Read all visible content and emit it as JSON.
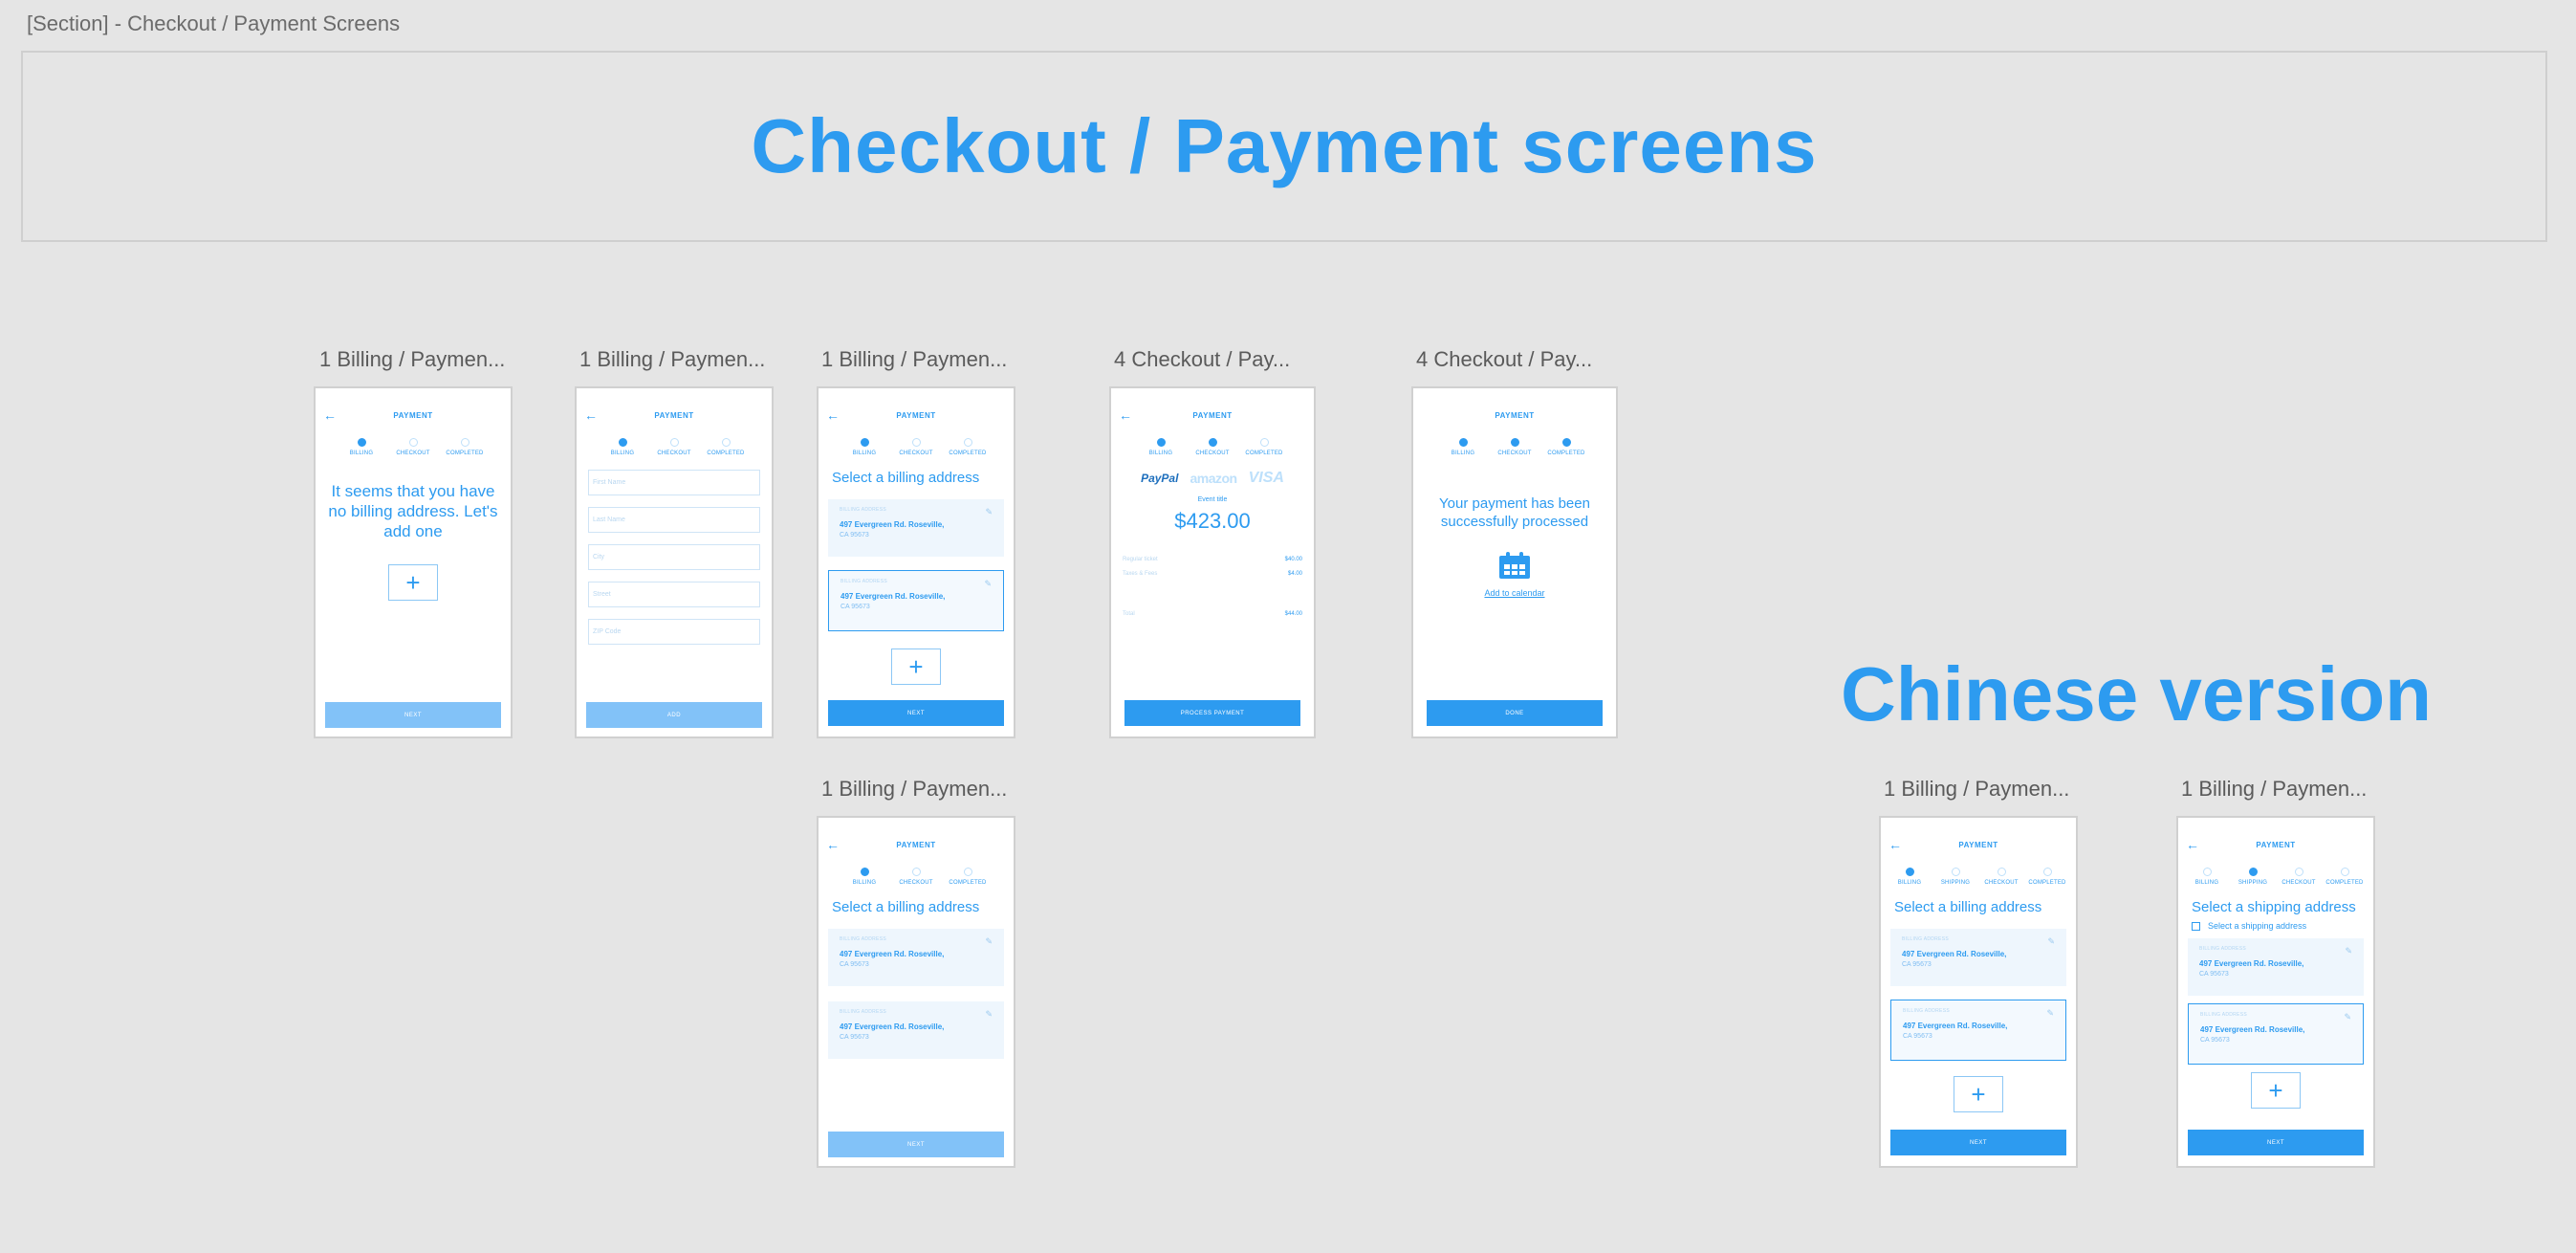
{
  "section_label": "[Section] - Checkout / Payment Screens",
  "banner_title": "Checkout / Payment screens",
  "chinese_title": "Chinese version",
  "labels": {
    "billing": "1 Billing / Paymen...",
    "checkout": "4 Checkout / Pay..."
  },
  "screen": {
    "header_title": "PAYMENT",
    "back_icon": "arrow-left-icon",
    "steps3": [
      "BILLING",
      "CHECKOUT",
      "COMPLETED"
    ],
    "steps4": [
      "BILLING",
      "SHIPPING",
      "CHECKOUT",
      "COMPLETED"
    ]
  },
  "empty_message": "It seems that you have no billing address. Let's add one",
  "next_label": "NEXT",
  "add_label": "ADD",
  "done_label": "DONE",
  "process_label": "PROCESS PAYMENT",
  "form_placeholders": [
    "First Name",
    "Last Name",
    "City",
    "Street",
    "ZIP Code"
  ],
  "select_billing": "Select a billing address",
  "select_shipping": "Select a shipping address",
  "address": {
    "caption": "BILLING ADDRESS",
    "line1": "497 Evergreen Rd. Roseville,",
    "line2": "CA 95673"
  },
  "payment": {
    "brands": [
      "PayPal",
      "amazon",
      "VISA"
    ],
    "event_title": "Event title",
    "amount": "$423.00",
    "rows": [
      {
        "k": "Regular ticket",
        "v": "$40.00"
      },
      {
        "k": "Taxes & Fees",
        "v": "$4.00"
      },
      {
        "k": "Total",
        "v": "$44.00"
      }
    ]
  },
  "success": {
    "message": "Your payment has been successfully processed",
    "calendar_link": "Add to calendar"
  },
  "colors": {
    "accent": "#2d9bf0",
    "light_button": "#82c2f8",
    "background": "#e5e5e5"
  }
}
